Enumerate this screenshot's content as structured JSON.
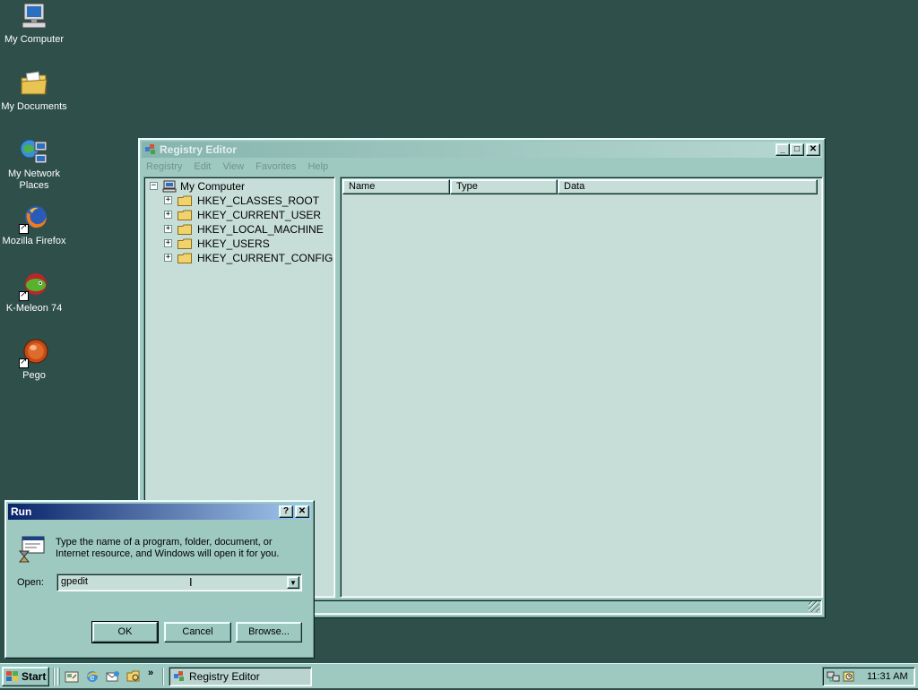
{
  "desktop": {
    "icons": [
      {
        "label": "My Computer",
        "icon": "computer-icon"
      },
      {
        "label": "My Documents",
        "icon": "folder-documents-icon"
      },
      {
        "label": "My Network Places",
        "icon": "network-icon"
      },
      {
        "label": "Mozilla Firefox",
        "icon": "firefox-icon",
        "shortcut": true
      },
      {
        "label": "K-Meleon 74",
        "icon": "kmeleon-icon",
        "shortcut": true
      },
      {
        "label": "Pego",
        "icon": "pego-icon",
        "shortcut": true
      }
    ]
  },
  "regedit": {
    "title": "Registry Editor",
    "menu": [
      "Registry",
      "Edit",
      "View",
      "Favorites",
      "Help"
    ],
    "tree": {
      "root": "My Computer",
      "keys": [
        "HKEY_CLASSES_ROOT",
        "HKEY_CURRENT_USER",
        "HKEY_LOCAL_MACHINE",
        "HKEY_USERS",
        "HKEY_CURRENT_CONFIG"
      ]
    },
    "columns": [
      "Name",
      "Type",
      "Data"
    ]
  },
  "run_dialog": {
    "title": "Run",
    "description": "Type the name of a program, folder, document, or Internet resource, and Windows will open it for you.",
    "open_label": "Open:",
    "open_value": "gpedit",
    "buttons": {
      "ok": "OK",
      "cancel": "Cancel",
      "browse": "Browse..."
    }
  },
  "taskbar": {
    "start_label": "Start",
    "task": "Registry Editor",
    "clock": "11:31 AM"
  },
  "colors": {
    "desktop": "#2e4f4a",
    "window_face": "#9ec9c1",
    "active_title_start": "#0a246a",
    "active_title_end": "#a6caf0"
  }
}
